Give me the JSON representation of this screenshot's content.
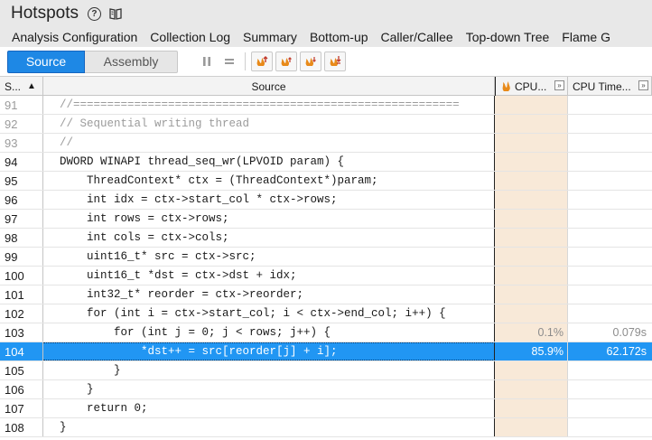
{
  "header": {
    "title": "Hotspots"
  },
  "tabs": [
    "Analysis Configuration",
    "Collection Log",
    "Summary",
    "Bottom-up",
    "Caller/Callee",
    "Top-down Tree",
    "Flame G"
  ],
  "toolbar": {
    "source_label": "Source",
    "assembly_label": "Assembly"
  },
  "grid": {
    "columns": {
      "line": "S...",
      "source": "Source",
      "cpu": "CPU...",
      "cpu_time": "CPU Time..."
    },
    "rows": [
      {
        "line": "91",
        "code": "//=========================================================",
        "cpu": "",
        "time": "",
        "kind": "comment"
      },
      {
        "line": "92",
        "code": "// Sequential writing thread",
        "cpu": "",
        "time": "",
        "kind": "comment"
      },
      {
        "line": "93",
        "code": "//",
        "cpu": "",
        "time": "",
        "kind": "comment"
      },
      {
        "line": "94",
        "code": "DWORD WINAPI thread_seq_wr(LPVOID param) {",
        "cpu": "",
        "time": "",
        "kind": "code"
      },
      {
        "line": "95",
        "code": "    ThreadContext* ctx = (ThreadContext*)param;",
        "cpu": "",
        "time": "",
        "kind": "code"
      },
      {
        "line": "96",
        "code": "    int idx = ctx->start_col * ctx->rows;",
        "cpu": "",
        "time": "",
        "kind": "code"
      },
      {
        "line": "97",
        "code": "    int rows = ctx->rows;",
        "cpu": "",
        "time": "",
        "kind": "code"
      },
      {
        "line": "98",
        "code": "    int cols = ctx->cols;",
        "cpu": "",
        "time": "",
        "kind": "code"
      },
      {
        "line": "99",
        "code": "    uint16_t* src = ctx->src;",
        "cpu": "",
        "time": "",
        "kind": "code"
      },
      {
        "line": "100",
        "code": "    uint16_t *dst = ctx->dst + idx;",
        "cpu": "",
        "time": "",
        "kind": "code"
      },
      {
        "line": "101",
        "code": "    int32_t* reorder = ctx->reorder;",
        "cpu": "",
        "time": "",
        "kind": "code"
      },
      {
        "line": "102",
        "code": "    for (int i = ctx->start_col; i < ctx->end_col; i++) {",
        "cpu": "",
        "time": "",
        "kind": "code"
      },
      {
        "line": "103",
        "code": "        for (int j = 0; j < rows; j++) {",
        "cpu": "0.1%",
        "time": "0.079s",
        "kind": "muted"
      },
      {
        "line": "104",
        "code": "            *dst++ = src[reorder[j] + i];",
        "cpu": "85.9%",
        "time": "62.172s",
        "kind": "selected"
      },
      {
        "line": "105",
        "code": "        }",
        "cpu": "",
        "time": "",
        "kind": "code"
      },
      {
        "line": "106",
        "code": "    }",
        "cpu": "",
        "time": "",
        "kind": "code"
      },
      {
        "line": "107",
        "code": "    return 0;",
        "cpu": "",
        "time": "",
        "kind": "code"
      },
      {
        "line": "108",
        "code": "}",
        "cpu": "",
        "time": "",
        "kind": "code"
      }
    ]
  },
  "colors": {
    "accent": "#1e88e5",
    "selected_row": "#2196f3",
    "cpu_column_bg": "#f8e9d8",
    "flame": "#e88a1a"
  },
  "icons": [
    "help-icon",
    "docs-book-icon",
    "pause-icon",
    "equals-icon",
    "flame-up-icon",
    "flame-next-up-icon",
    "flame-next-down-icon",
    "flame-down-icon",
    "flame-icon"
  ]
}
